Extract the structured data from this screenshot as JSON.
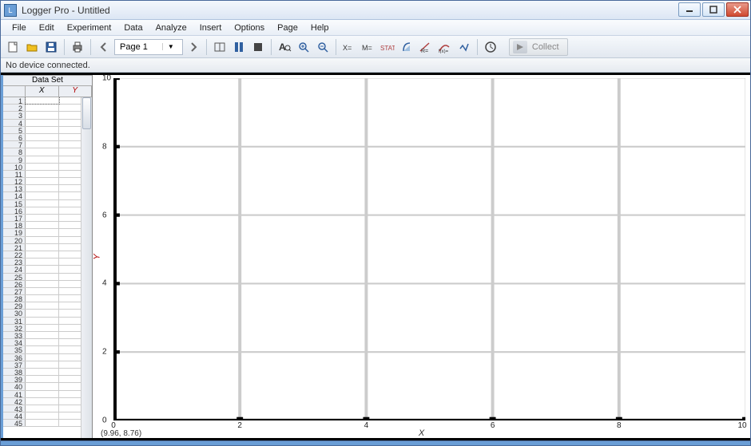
{
  "window": {
    "title": "Logger Pro - Untitled"
  },
  "menu": {
    "items": [
      "File",
      "Edit",
      "Experiment",
      "Data",
      "Analyze",
      "Insert",
      "Options",
      "Page",
      "Help"
    ]
  },
  "toolbar": {
    "page_selector": "Page 1",
    "collect_label": "Collect"
  },
  "infobar": {
    "status": "No device connected."
  },
  "dataset": {
    "title": "Data Set",
    "columns": {
      "x": "X",
      "y": "Y"
    },
    "row_count": 45
  },
  "graph": {
    "xlabel": "X",
    "ylabel": "Y",
    "coords": "(9.96, 8.76)",
    "xticks": [
      "0",
      "2",
      "4",
      "6",
      "8",
      "10"
    ],
    "yticks": [
      "0",
      "2",
      "4",
      "6",
      "8",
      "10"
    ]
  },
  "chart_data": {
    "type": "scatter",
    "title": "",
    "xlabel": "X",
    "ylabel": "Y",
    "xlim": [
      0,
      10
    ],
    "ylim": [
      0,
      10
    ],
    "series": [
      {
        "name": "Y",
        "x": [],
        "y": []
      }
    ]
  }
}
